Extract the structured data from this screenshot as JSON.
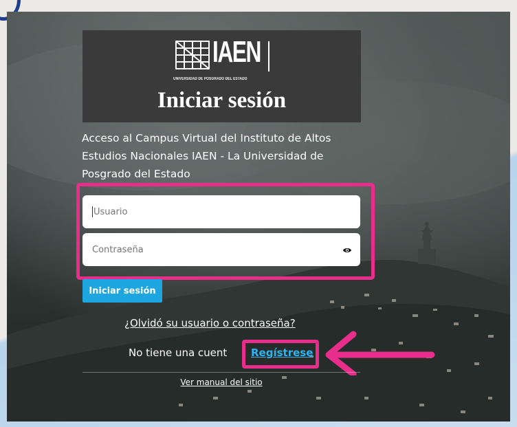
{
  "logo": {
    "name": "IAEN",
    "subtitle": "UNIVERSIDAD DE POSGRADO DEL ESTADO"
  },
  "login": {
    "title": "Iniciar sesión",
    "description": "Acceso al Campus Virtual del Instituto de Altos Estudios Nacionales IAEN - La Universidad de Posgrado del Estado",
    "username_placeholder": "Usuario",
    "password_placeholder": "Contraseña",
    "submit_label": "Iniciar sesión",
    "forgot_link": "¿Olvidó su usuario o contraseña?",
    "no_account_text": "No tiene una cuent",
    "register_link": "Regístrese",
    "manual_link": "Ver manual del sitio"
  },
  "icons": {
    "password_toggle": "eye-icon",
    "annotation": "arrow-left-icon"
  },
  "colors": {
    "highlight": "#e62e8a",
    "button": "#1ea6e0",
    "register_link": "#2fb2ef",
    "logo_background": "#3a3a3a"
  }
}
